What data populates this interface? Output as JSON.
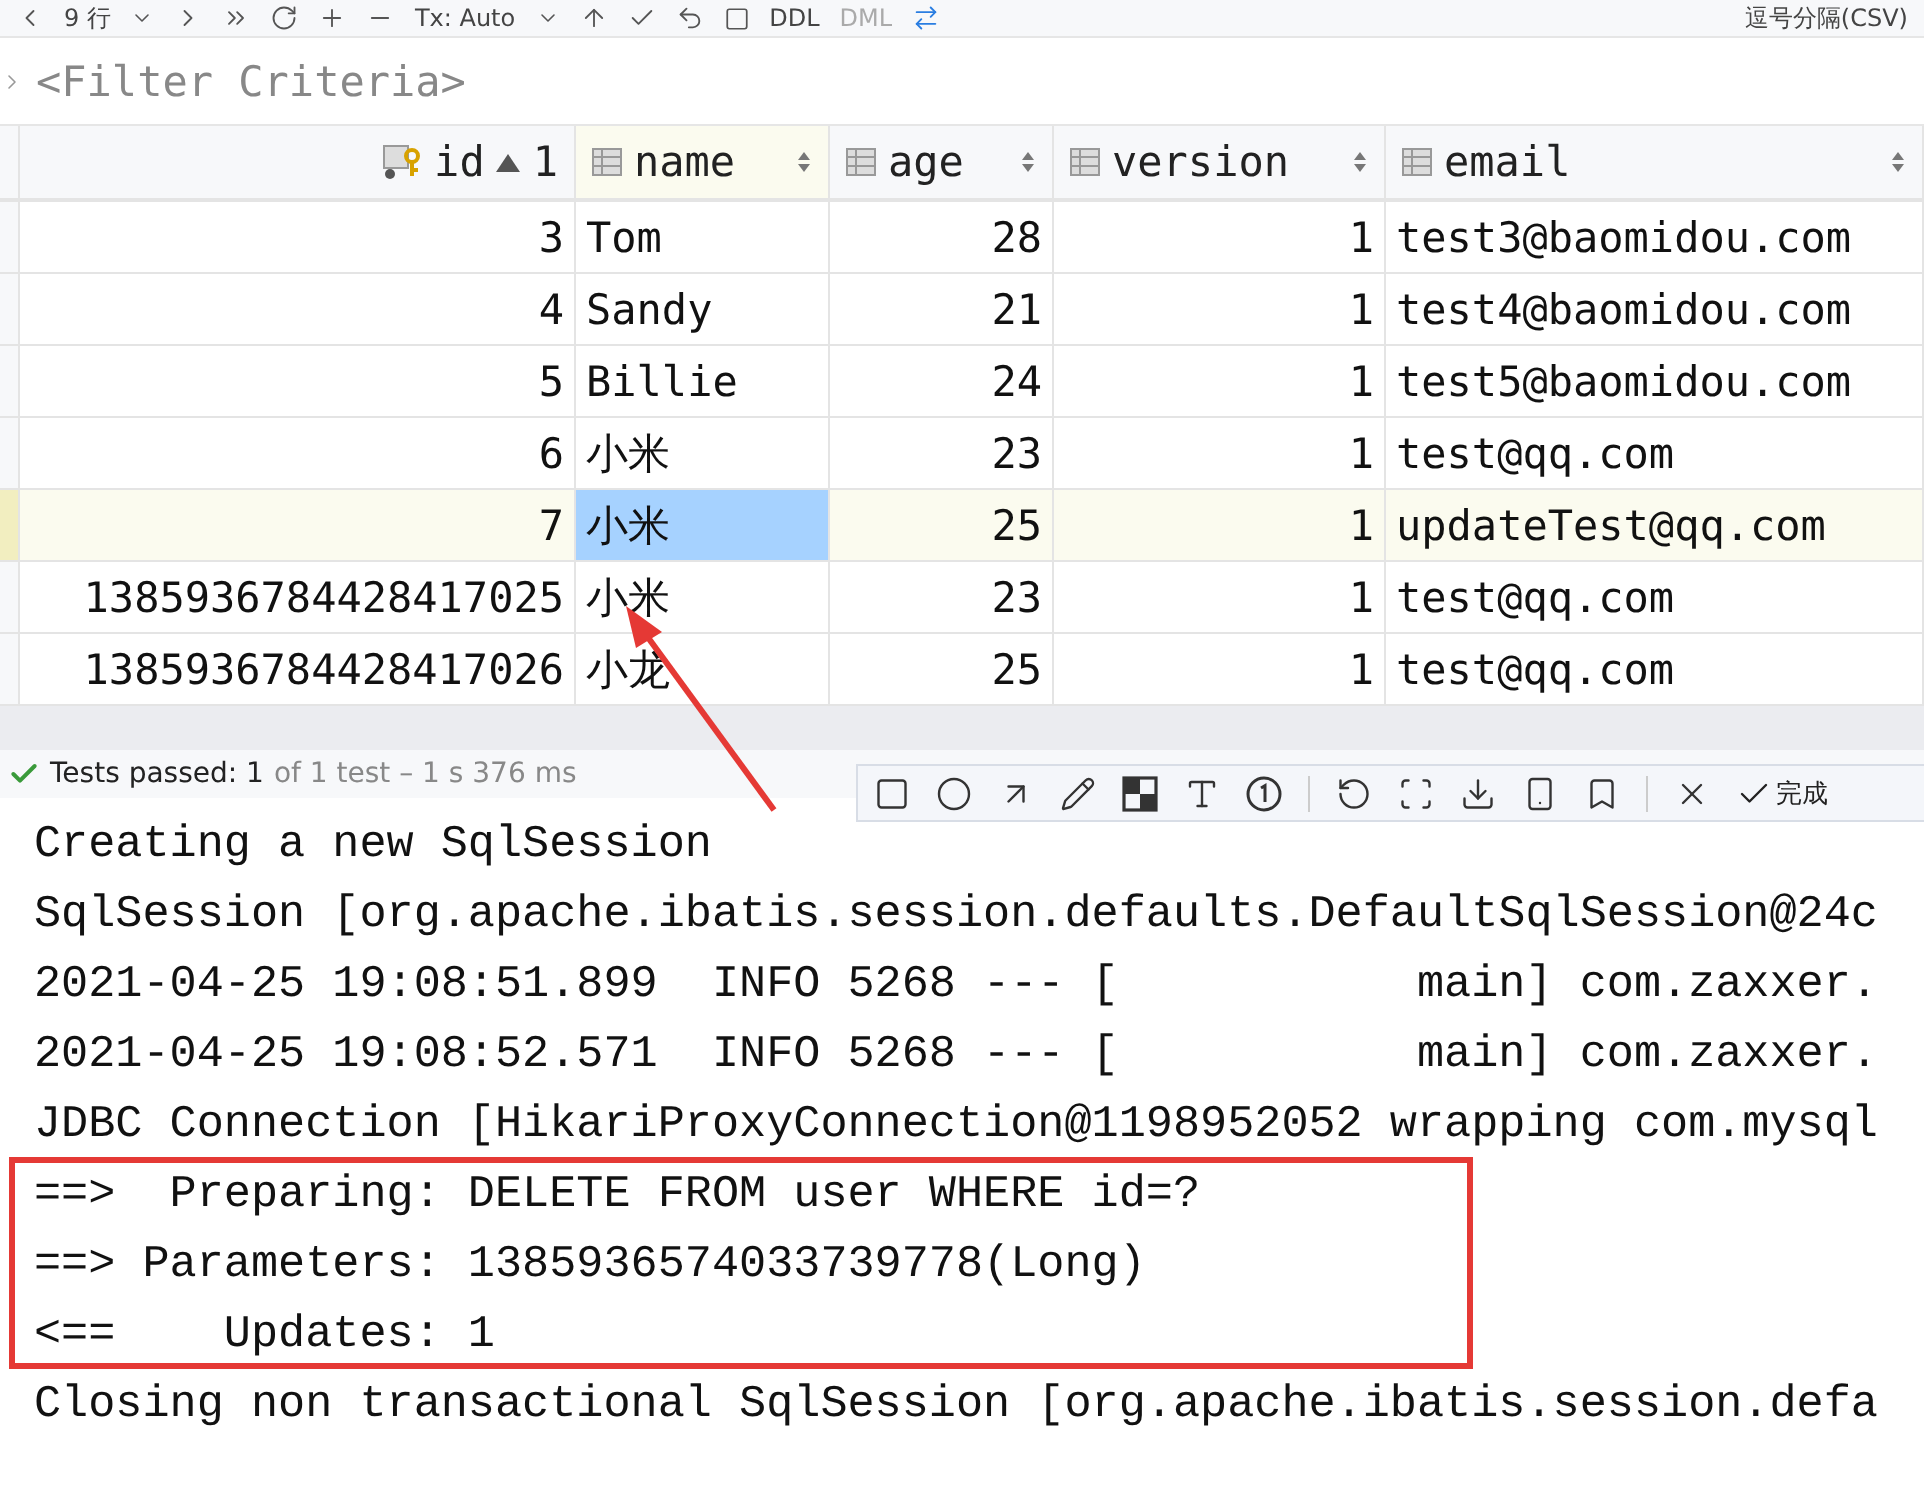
{
  "toolbar": {
    "rows_label": "9 行",
    "tx_label": "Tx: Auto",
    "ddl": "DDL",
    "dml": "DML",
    "export_format": "逗号分隔(CSV)"
  },
  "filter": {
    "placeholder": "<Filter Criteria>"
  },
  "table": {
    "columns": [
      {
        "label": "id",
        "kind": "key",
        "sort_order": "1"
      },
      {
        "label": "name",
        "kind": "text"
      },
      {
        "label": "age",
        "kind": "number"
      },
      {
        "label": "version",
        "kind": "number"
      },
      {
        "label": "email",
        "kind": "text"
      }
    ],
    "rows": [
      {
        "current": false,
        "cells": [
          {
            "text": "3",
            "selected": false
          },
          {
            "text": "Tom",
            "selected": false
          },
          {
            "text": "28",
            "selected": false
          },
          {
            "text": "1",
            "selected": false
          },
          {
            "text": "test3@baomidou.com",
            "selected": false
          }
        ]
      },
      {
        "current": false,
        "cells": [
          {
            "text": "4",
            "selected": false
          },
          {
            "text": "Sandy",
            "selected": false
          },
          {
            "text": "21",
            "selected": false
          },
          {
            "text": "1",
            "selected": false
          },
          {
            "text": "test4@baomidou.com",
            "selected": false
          }
        ]
      },
      {
        "current": false,
        "cells": [
          {
            "text": "5",
            "selected": false
          },
          {
            "text": "Billie",
            "selected": false
          },
          {
            "text": "24",
            "selected": false
          },
          {
            "text": "1",
            "selected": false
          },
          {
            "text": "test5@baomidou.com",
            "selected": false
          }
        ]
      },
      {
        "current": false,
        "cells": [
          {
            "text": "6",
            "selected": false
          },
          {
            "text": "小米",
            "selected": false
          },
          {
            "text": "23",
            "selected": false
          },
          {
            "text": "1",
            "selected": false
          },
          {
            "text": "test@qq.com",
            "selected": false
          }
        ]
      },
      {
        "current": true,
        "cells": [
          {
            "text": "7",
            "selected": false
          },
          {
            "text": "小米",
            "selected": true
          },
          {
            "text": "25",
            "selected": false
          },
          {
            "text": "1",
            "selected": false
          },
          {
            "text": "updateTest@qq.com",
            "selected": false
          }
        ]
      },
      {
        "current": false,
        "cells": [
          {
            "text": "1385936784428417025",
            "selected": false
          },
          {
            "text": "小米",
            "selected": false
          },
          {
            "text": "23",
            "selected": false
          },
          {
            "text": "1",
            "selected": false
          },
          {
            "text": "test@qq.com",
            "selected": false
          }
        ]
      },
      {
        "current": false,
        "cells": [
          {
            "text": "1385936784428417026",
            "selected": false
          },
          {
            "text": "小龙",
            "selected": false
          },
          {
            "text": "25",
            "selected": false
          },
          {
            "text": "1",
            "selected": false
          },
          {
            "text": "test@qq.com",
            "selected": false
          }
        ]
      }
    ]
  },
  "tests": {
    "status": "Tests passed: 1",
    "detail": "of 1 test – 1 s 376 ms",
    "passed": true
  },
  "capture_toolbar": {
    "done_label": "完成"
  },
  "console": [
    "Creating a new SqlSession",
    "SqlSession [org.apache.ibatis.session.defaults.DefaultSqlSession@24c",
    "2021-04-25 19:08:51.899  INFO 5268 --- [           main] com.zaxxer.",
    "2021-04-25 19:08:52.571  INFO 5268 --- [           main] com.zaxxer.",
    "JDBC Connection [HikariProxyConnection@1198952052 wrapping com.mysql",
    "==>  Preparing: DELETE FROM user WHERE id=?",
    "==> Parameters: 1385936574033739778(Long)",
    "<==    Updates: 1",
    "Closing non transactional SqlSession [org.apache.ibatis.session.defa"
  ]
}
